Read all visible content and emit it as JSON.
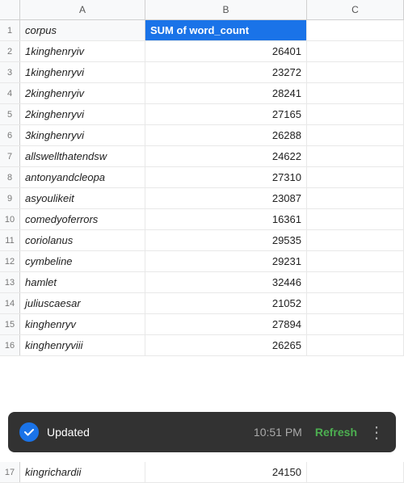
{
  "columns": {
    "a_label": "A",
    "b_label": "B",
    "c_label": "C"
  },
  "header_row": {
    "corpus": "corpus",
    "sum_word_count": "SUM of word_count"
  },
  "rows": [
    {
      "corpus": "1kinghenryiv",
      "value": "26401"
    },
    {
      "corpus": "1kinghenryvi",
      "value": "23272"
    },
    {
      "corpus": "2kinghenryiv",
      "value": "28241"
    },
    {
      "corpus": "2kinghenryvi",
      "value": "27165"
    },
    {
      "corpus": "3kinghenryvi",
      "value": "26288"
    },
    {
      "corpus": "allswellthatendsw",
      "value": "24622"
    },
    {
      "corpus": "antonyandcleopa",
      "value": "27310"
    },
    {
      "corpus": "asyoulikeit",
      "value": "23087"
    },
    {
      "corpus": "comedyoferrors",
      "value": "16361"
    },
    {
      "corpus": "coriolanus",
      "value": "29535"
    },
    {
      "corpus": "cymbeline",
      "value": "29231"
    },
    {
      "corpus": "hamlet",
      "value": "32446"
    },
    {
      "corpus": "juliuscaesar",
      "value": "21052"
    },
    {
      "corpus": "kinghenryv",
      "value": "27894"
    },
    {
      "corpus": "kinghenryviii",
      "value": "26265"
    }
  ],
  "partial_row": {
    "corpus": "kingrichardii",
    "value": "24150"
  },
  "snackbar": {
    "status": "Updated",
    "time": "10:51 PM",
    "refresh_label": "Refresh",
    "more_icon": "⋮"
  }
}
